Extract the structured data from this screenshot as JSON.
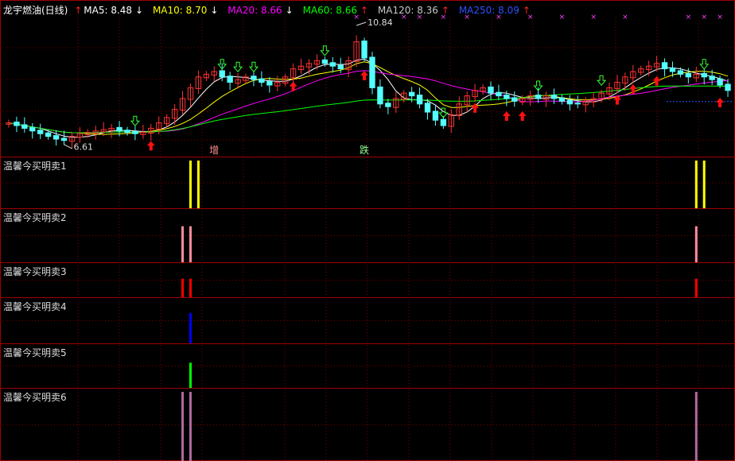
{
  "header": {
    "title": "龙宇燃油(日线)",
    "ma": [
      {
        "label": "MA5: 8.48",
        "color": "#ffffff",
        "arrow": "down"
      },
      {
        "label": "MA10: 8.70",
        "color": "#ffff00",
        "arrow": "down"
      },
      {
        "label": "MA20: 8.66",
        "color": "#ff00ff",
        "arrow": "down"
      },
      {
        "label": "MA60: 8.66",
        "color": "#00ff00",
        "arrow": "up"
      },
      {
        "label": "MA120: 8.36",
        "color": "#c8c8c8",
        "arrow": "up"
      },
      {
        "label": "MA250: 8.09",
        "color": "#3050ff",
        "arrow": "up"
      }
    ]
  },
  "chart_data": {
    "type": "candlestick",
    "annotations": {
      "high": "10.84",
      "low": "6.61",
      "mark_zeng": "增",
      "mark_die": "跌"
    },
    "price_range": [
      6.2,
      11.2
    ],
    "closes": [
      7.3,
      7.2,
      7.1,
      7.0,
      6.9,
      6.8,
      6.7,
      6.65,
      6.8,
      6.9,
      6.95,
      7.0,
      7.05,
      7.1,
      7.0,
      6.95,
      6.9,
      6.95,
      7.1,
      7.3,
      7.5,
      7.8,
      8.2,
      8.6,
      9.0,
      9.1,
      9.2,
      9.0,
      8.8,
      8.9,
      9.0,
      8.9,
      8.8,
      8.7,
      8.8,
      9.0,
      9.3,
      9.4,
      9.5,
      9.6,
      9.5,
      9.4,
      9.3,
      9.6,
      10.3,
      9.7,
      8.6,
      8.0,
      7.9,
      8.2,
      8.4,
      8.3,
      8.0,
      7.7,
      7.4,
      7.2,
      7.6,
      8.0,
      8.3,
      8.5,
      8.6,
      8.4,
      8.3,
      8.2,
      8.1,
      8.2,
      8.3,
      8.2,
      8.3,
      8.2,
      8.1,
      8.0,
      8.0,
      8.1,
      8.2,
      8.4,
      8.6,
      8.8,
      9.0,
      9.2,
      9.3,
      9.4,
      9.5,
      9.3,
      9.2,
      9.1,
      9.0,
      9.1,
      9.0,
      8.9,
      8.7,
      8.5
    ],
    "buy_arrow_idx": [
      18,
      36,
      45,
      59,
      63,
      65,
      77,
      79,
      82,
      90
    ],
    "sell_arrow_idx": [
      16,
      27,
      29,
      31,
      40,
      55,
      67,
      75,
      88
    ],
    "x_marks_idx": [
      44,
      50,
      52,
      55,
      58,
      62,
      66,
      70,
      74,
      78,
      86,
      88,
      90
    ]
  },
  "indicators": [
    {
      "label": "温馨今买明卖1",
      "color": "#ffff00",
      "bars_idx": [
        23,
        24,
        87,
        88
      ],
      "fill": 1.0
    },
    {
      "label": "温馨今买明卖2",
      "color": "#ff8ca0",
      "bars_idx": [
        22,
        23,
        87
      ],
      "fill": 0.72
    },
    {
      "label": "温馨今买明卖3",
      "color": "#ff0000",
      "bars_idx": [
        22,
        23,
        87
      ],
      "fill": 0.6
    },
    {
      "label": "温馨今买明卖4",
      "color": "#0000ff",
      "bars_idx": [
        23
      ],
      "fill": 0.72
    },
    {
      "label": "温馨今买明卖5",
      "color": "#00ff00",
      "bars_idx": [
        23
      ],
      "fill": 0.62
    },
    {
      "label": "温馨今买明卖6",
      "color": "#b06aa0",
      "bars_idx": [
        22,
        23,
        87
      ],
      "fill": 1.0
    }
  ],
  "colors": {
    "up": "#ff3232",
    "down": "#54ffff",
    "grid": "#800000",
    "border": "#a00000"
  }
}
